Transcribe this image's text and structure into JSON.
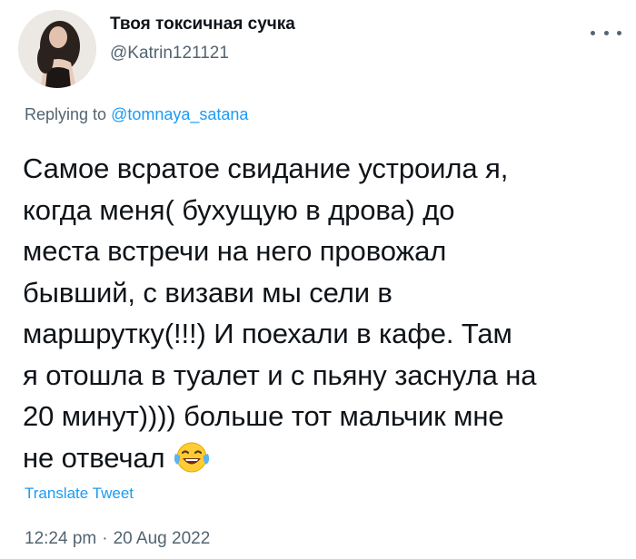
{
  "author": {
    "display_name": "Твоя токсичная сучка",
    "handle": "@Katrin121121",
    "avatar_icon": "profile-photo"
  },
  "actions": {
    "more_icon": "more-horizontal-icon"
  },
  "reply": {
    "prefix": "Replying to",
    "mention": "@tomnaya_satana"
  },
  "tweet": {
    "lines": [
      "Самое всратое свидание устроила я,",
      "когда меня( бухущую в дрова) до",
      "места встречи на него провожал",
      "бывший, с визави мы сели в",
      "маршрутку(!!!) И поехали в кафе. Там",
      "я отошла в туалет и с пьяну заснула на",
      "20 минут)))) больше тот мальчик мне",
      "не отвечал"
    ],
    "emoji": "laughing-with-tears-emoji"
  },
  "translate_label": "Translate Tweet",
  "meta": {
    "time": "12:24 pm",
    "separator": "·",
    "date": "20 Aug 2022"
  },
  "colors": {
    "text": "#0f1419",
    "secondary": "#536471",
    "accent": "#1d9bf0"
  }
}
